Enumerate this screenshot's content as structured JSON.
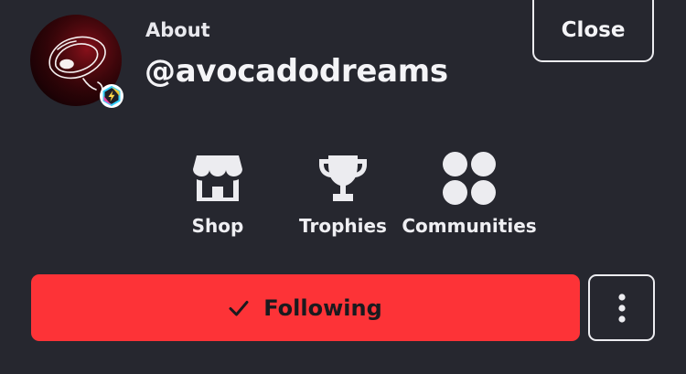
{
  "profile": {
    "about_label": "About",
    "username": "@avocadodreams",
    "avatar_icon": "avocado-drawing-avatar",
    "badge_icon": "lightning-hexagon-badge"
  },
  "header": {
    "close_label": "Close"
  },
  "nav": {
    "items": [
      {
        "label": "Shop",
        "icon": "storefront-icon"
      },
      {
        "label": "Trophies",
        "icon": "trophy-icon"
      },
      {
        "label": "Communities",
        "icon": "four-circles-icon"
      }
    ]
  },
  "actions": {
    "following_label": "Following",
    "following_icon": "checkmark-icon",
    "more_icon": "vertical-ellipsis-icon",
    "following_color": "#fd3337"
  },
  "theme": {
    "background": "#26272f",
    "text": "#f3f3f6"
  }
}
